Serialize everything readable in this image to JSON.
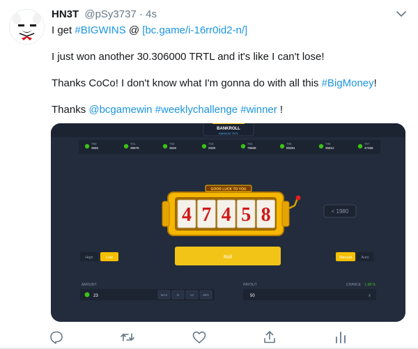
{
  "tweet": {
    "display_name": "HN3T",
    "handle": "@pSy3737",
    "separator": "·",
    "time": "4s",
    "line1": {
      "prefix": "I get ",
      "hashtag1": "#BIGWINS",
      "mid": " @ ",
      "link": "[bc.game/i-16rr0id2-n/]"
    },
    "line2": "I just won another 30.306000 TRTL and it's like I can't lose!",
    "line3": {
      "prefix": "Thanks CoCo! I don't know what I'm gonna do with all this ",
      "hashtag": "#BigMoney",
      "suffix": "!"
    },
    "line4": {
      "prefix": "Thanks ",
      "mention": "@bcgamewin",
      "hashtag1": "#weeklychallenge",
      "hashtag2": "#winner",
      "suffix": " !"
    }
  },
  "game": {
    "bankroll_label": "BANKROLL",
    "bankroll_value": "34596132 TRTL",
    "history": [
      {
        "id": "700",
        "value": "3665"
      },
      {
        "id": "701",
        "value": "39678"
      },
      {
        "id": "702",
        "value": "3626"
      },
      {
        "id": "703",
        "value": "2639"
      },
      {
        "id": "704",
        "value": "76569"
      },
      {
        "id": "705",
        "value": "89381"
      },
      {
        "id": "706",
        "value": "35812"
      },
      {
        "id": "707",
        "value": "47458"
      }
    ],
    "banner": "GOOD LUCK TO YOU",
    "reels": [
      "4",
      "7",
      "4",
      "5",
      "8"
    ],
    "target": "< 1980",
    "high_label": "High",
    "low_label": "Low",
    "roll_label": "Roll",
    "manual_label": "Manual",
    "auto_label": "Auto",
    "amount_label": "AMOUNT",
    "amount_value": "23",
    "amount_buttons": [
      "MAX",
      "/2",
      "x2",
      "MIN"
    ],
    "payout_label": "PAYOUT",
    "payout_value": "50",
    "payout_suffix": "x",
    "chance_label": "CHANCE",
    "chance_value": "1.98 %"
  },
  "colors": {
    "link": "#1b95e0",
    "muted": "#657786",
    "game_bg": "#232c3c",
    "accent_green": "#3bc117",
    "gold": "#f5c000",
    "reel_red": "#d01818"
  },
  "icons": [
    "reply-icon",
    "retweet-icon",
    "like-icon",
    "share-icon",
    "analytics-icon",
    "chevron-down-icon"
  ]
}
